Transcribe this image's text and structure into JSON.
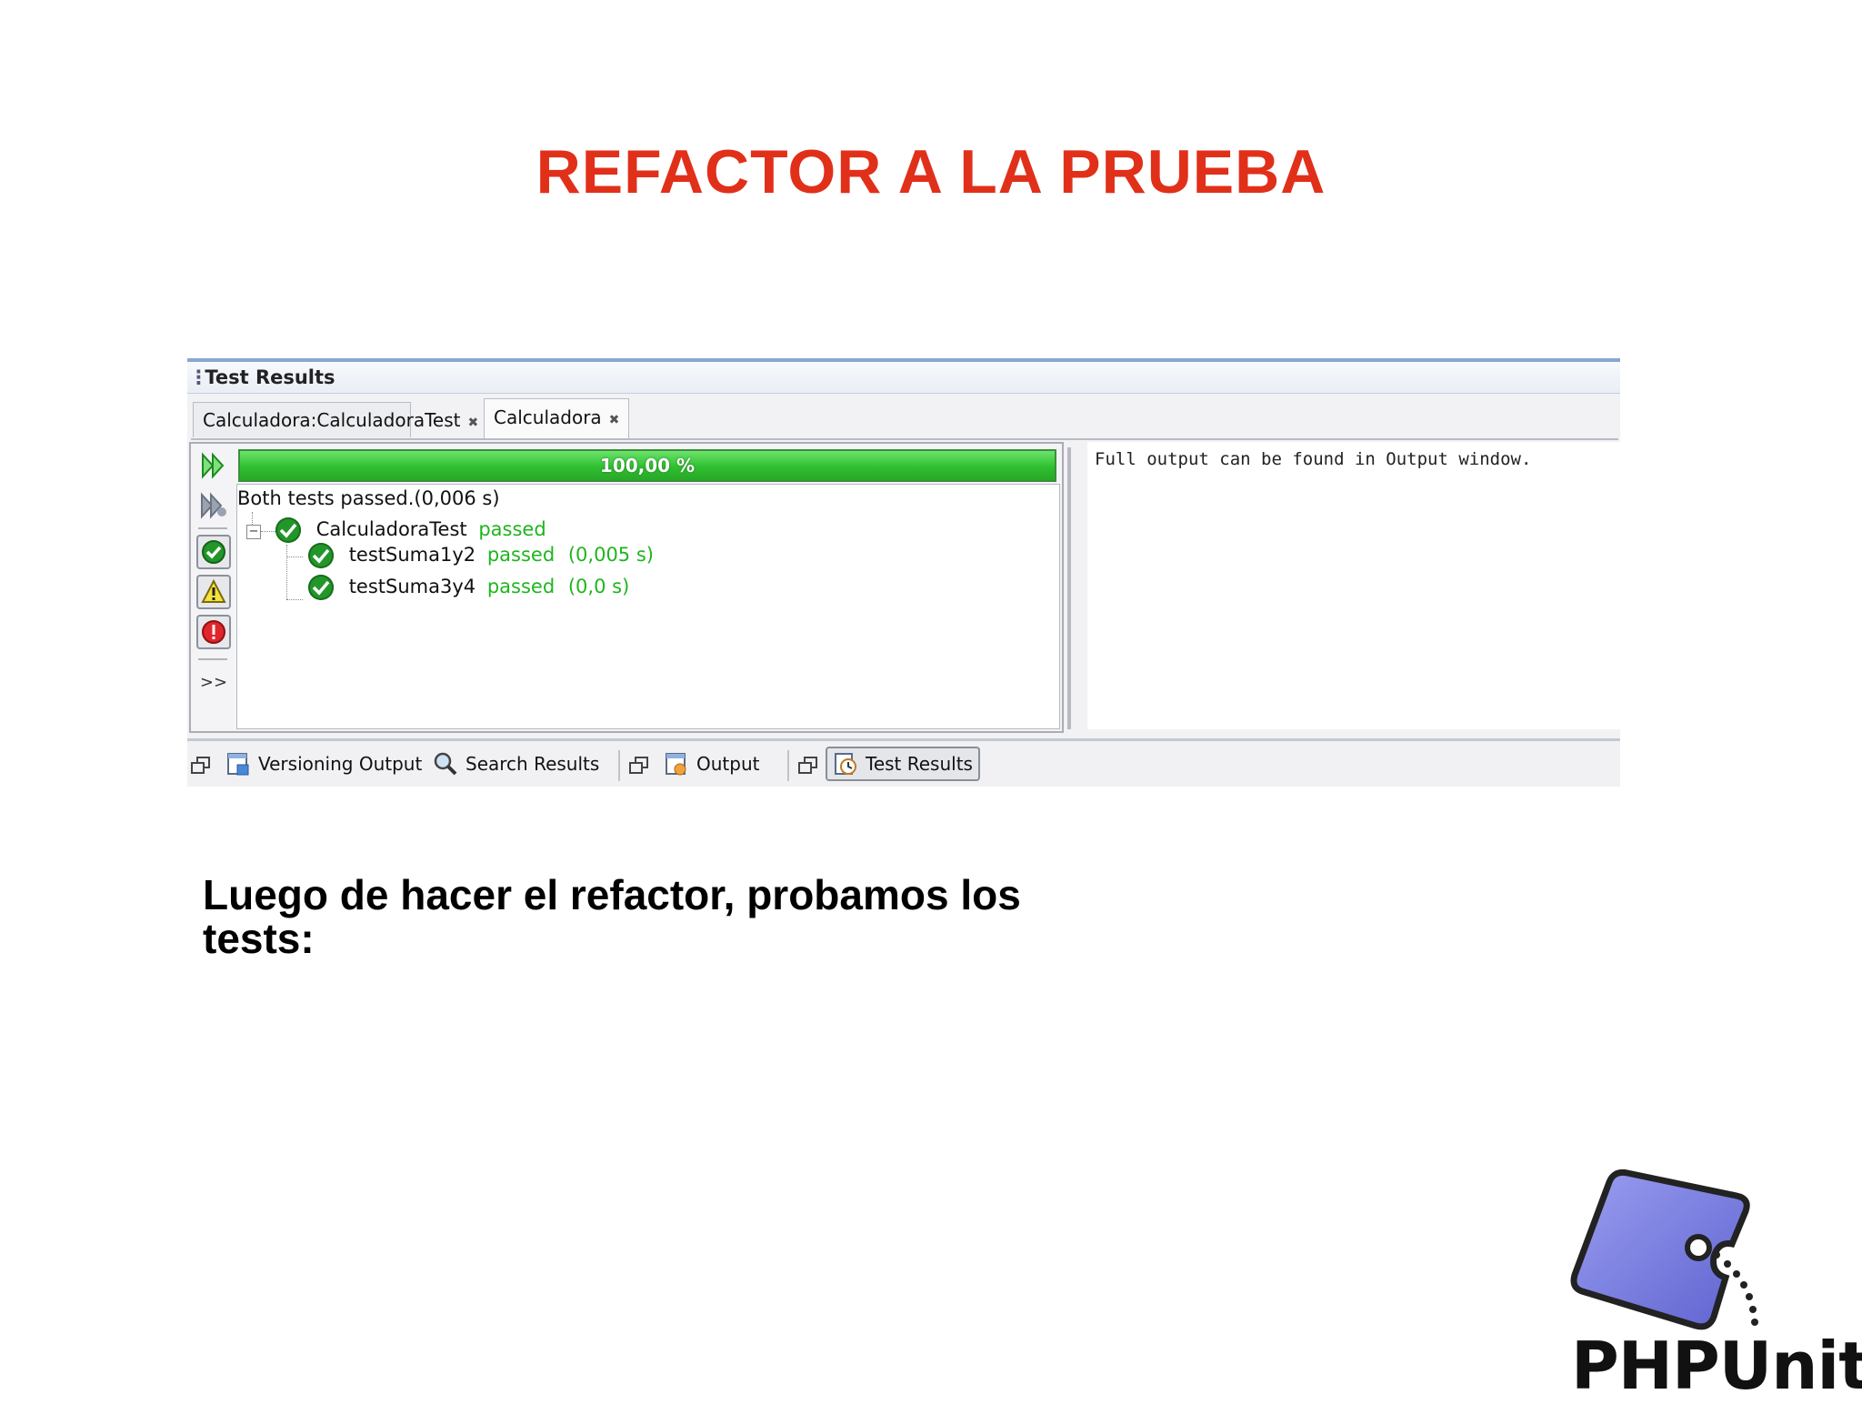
{
  "slide": {
    "title": "REFACTOR A LA PRUEBA",
    "caption": "Luego de hacer el refactor, probamos los tests:"
  },
  "window": {
    "title": "Test Results",
    "tabs": [
      {
        "label": "Calculadora:CalculadoraTest",
        "active": false
      },
      {
        "label": "Calculadora",
        "active": true
      }
    ]
  },
  "progress": {
    "label": "100,00 %",
    "value_percent": 100
  },
  "summary": "Both tests passed.(0,006 s)",
  "tree": {
    "suite": {
      "name": "CalculadoraTest",
      "status": "passed"
    },
    "tests": [
      {
        "name": "testSuma1y2",
        "status": "passed",
        "time": "(0,005 s)"
      },
      {
        "name": "testSuma3y4",
        "status": "passed",
        "time": "(0,0 s)"
      }
    ]
  },
  "output_text": "Full output can be found in Output window.",
  "toolbar": {
    "icons": [
      "rerun-icon",
      "rerun-failed-icon",
      "show-passed-icon",
      "show-warnings-icon",
      "show-errors-icon",
      "more-icon"
    ],
    "more_label": ">>"
  },
  "statusbar": {
    "items": [
      {
        "label": "Versioning Output",
        "icon": "versioning-output-icon"
      },
      {
        "label": "Search Results",
        "icon": "search-icon"
      },
      {
        "label": "Output",
        "icon": "output-icon"
      },
      {
        "label": "Test Results",
        "icon": "test-results-icon"
      }
    ]
  },
  "logo": {
    "text": "PHPUnit"
  },
  "colors": {
    "title": "#e1301a",
    "pass_green": "#1fb51f",
    "progress_green": "#2fbf2f",
    "logo_blue": "#7b7fe0"
  }
}
